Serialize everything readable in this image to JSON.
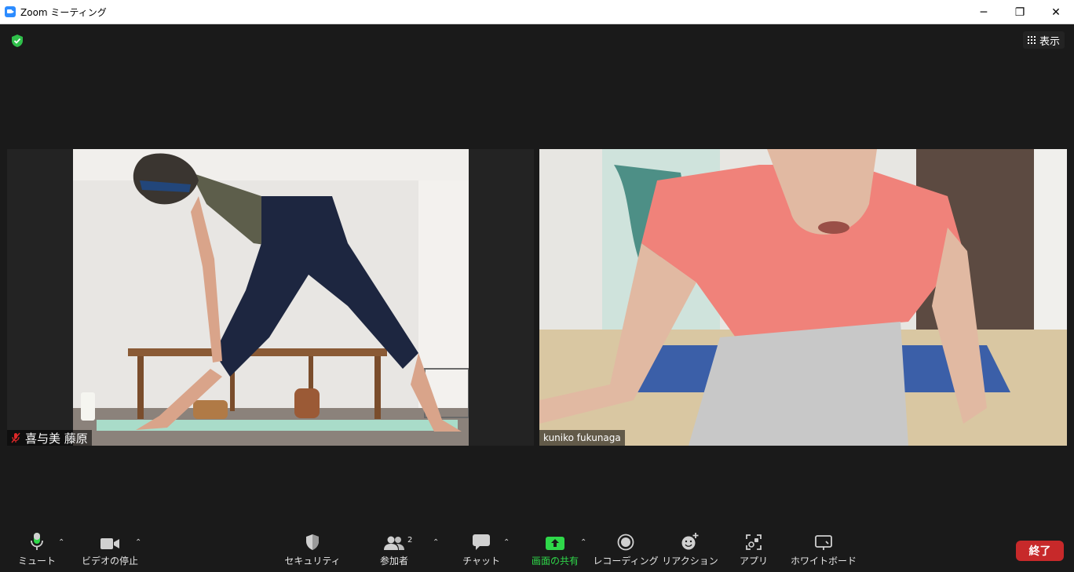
{
  "window": {
    "title": "Zoom ミーティング",
    "controls": {
      "minimize": "─",
      "restore": "❐",
      "close": "✕"
    }
  },
  "top_bar": {
    "view_label": "表示"
  },
  "participants": [
    {
      "name": "喜与美 藤原",
      "muted": true
    },
    {
      "name": "kuniko fukunaga",
      "muted": false
    }
  ],
  "toolbar": {
    "mute_label": "ミュート",
    "video_label": "ビデオの停止",
    "security_label": "セキュリティ",
    "participants_label": "参加者",
    "participants_count": "2",
    "chat_label": "チャット",
    "share_label": "画面の共有",
    "record_label": "レコーディング",
    "reaction_label": "リアクション",
    "apps_label": "アプリ",
    "whiteboard_label": "ホワイトボード",
    "caret": "⌃",
    "end_label": "終了"
  },
  "colors": {
    "background": "#1a1a1a",
    "share_green": "#2fd84a",
    "end_red": "#c7292a",
    "shield_green": "#2fbf4a"
  },
  "icons": [
    "zoom-logo-icon",
    "shield-check-icon",
    "grid-icon",
    "microphone-icon",
    "video-camera-icon",
    "security-shield-icon",
    "participants-icon",
    "chat-bubble-icon",
    "share-screen-icon",
    "record-icon",
    "reaction-icon",
    "apps-icon",
    "whiteboard-icon"
  ]
}
